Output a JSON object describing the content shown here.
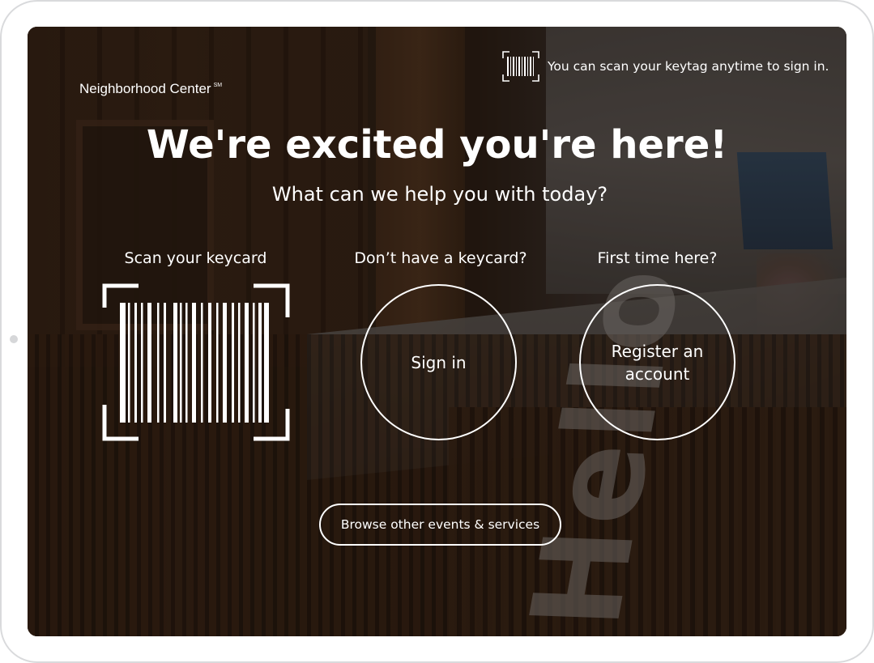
{
  "brand": {
    "name": "Neighborhood Center",
    "mark": "SM"
  },
  "scan_hint": {
    "icon": "barcode-icon",
    "text": "You can scan your keytag anytime to sign in."
  },
  "headline": "We're excited you're here!",
  "subheadline": "What can we help you with today?",
  "options": {
    "scan": {
      "label": "Scan your keycard",
      "icon": "barcode-scan-icon"
    },
    "no_keycard": {
      "label": "Don’t have a keycard?",
      "button": "Sign in"
    },
    "first_time": {
      "label": "First time here?",
      "button": "Register an account"
    }
  },
  "browse_button": "Browse other events & services",
  "background_sign": "Hello",
  "colors": {
    "text": "#ffffff",
    "frame": "#d9dadc",
    "overlay": "#231710"
  }
}
